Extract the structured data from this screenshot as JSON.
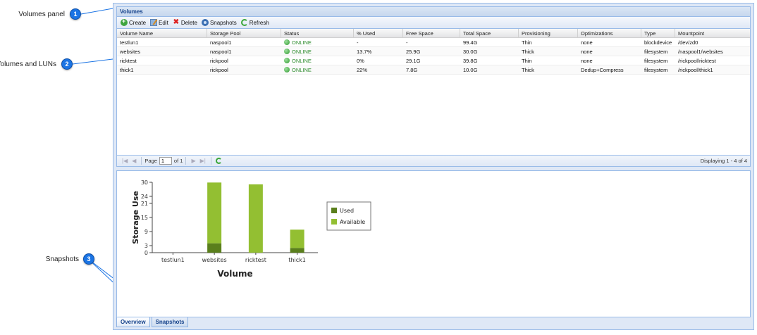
{
  "callouts": [
    {
      "number": "1",
      "label": "Volumes panel"
    },
    {
      "number": "2",
      "label": "Volumes and LUNs"
    },
    {
      "number": "3",
      "label": "Snapshots"
    }
  ],
  "volumes_panel": {
    "title": "Volumes",
    "toolbar": {
      "create": "Create",
      "edit": "Edit",
      "delete": "Delete",
      "snapshots": "Snapshots",
      "refresh": "Refresh"
    },
    "columns": [
      "Volume Name",
      "Storage Pool",
      "Status",
      "% Used",
      "Free Space",
      "Total Space",
      "Provisioning",
      "Optimizations",
      "Type",
      "Mountpoint"
    ],
    "rows": [
      [
        "testlun1",
        "naspool1",
        "ONLINE",
        "-",
        "-",
        "99.4G",
        "Thin",
        "none",
        "blockdevice",
        "/dev/zd0"
      ],
      [
        "websites",
        "naspool1",
        "ONLINE",
        "13.7%",
        "25.9G",
        "30.0G",
        "Thick",
        "none",
        "filesystem",
        "/naspool1/websites"
      ],
      [
        "ricktest",
        "rickpool",
        "ONLINE",
        "0%",
        "29.1G",
        "39.8G",
        "Thin",
        "none",
        "filesystem",
        "/rickpool/ricktest"
      ],
      [
        "thick1",
        "rickpool",
        "ONLINE",
        "22%",
        "7.8G",
        "10.0G",
        "Thick",
        "Dedup+Compress",
        "filesystem",
        "/rickpool/thick1"
      ]
    ],
    "pager": {
      "page_label": "Page",
      "page_value": "1",
      "of_label": "of 1",
      "display": "Displaying 1 - 4 of 4"
    }
  },
  "chart_data": {
    "type": "bar",
    "stacked": true,
    "categories": [
      "testlun1",
      "websites",
      "ricktest",
      "thick1"
    ],
    "series": [
      {
        "name": "Used",
        "values": [
          0,
          4,
          0,
          2
        ],
        "color": "#5a7f1c"
      },
      {
        "name": "Available",
        "values": [
          0,
          25.9,
          29.1,
          7.8
        ],
        "color": "#93bf32"
      }
    ],
    "xlabel": "Volume",
    "ylabel": "Storage Use",
    "ylim": [
      0,
      30
    ],
    "yticks": [
      0,
      3,
      9,
      15,
      21,
      24,
      30
    ],
    "legend": "right"
  },
  "tabs": [
    {
      "label": "Overview",
      "active": true
    },
    {
      "label": "Snapshots",
      "active": false
    }
  ],
  "colors": {
    "callout": "#1b74e4",
    "panel_border": "#99bbe8",
    "header_text": "#15428b",
    "status_online": "#2a8a2a"
  }
}
